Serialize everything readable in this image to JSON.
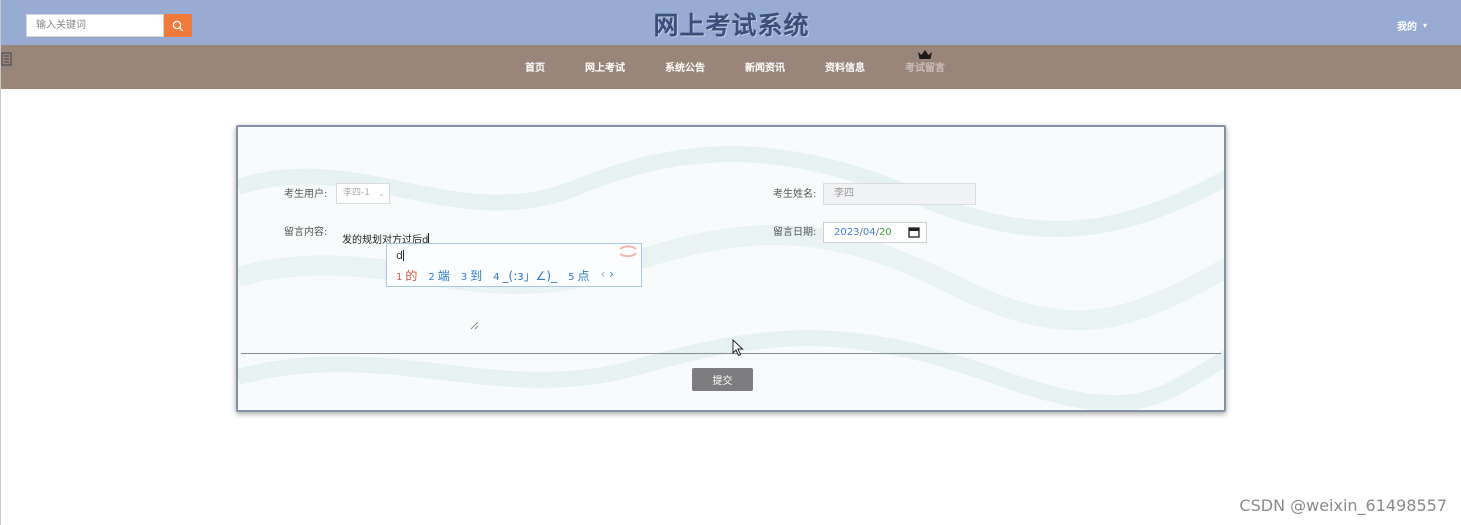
{
  "header": {
    "search_placeholder": "输入关键词",
    "title": "网上考试系统",
    "user_menu": "我的"
  },
  "nav": {
    "items": [
      "首页",
      "网上考试",
      "系统公告",
      "新闻资讯",
      "资料信息",
      "考试留言"
    ],
    "active_index": 5
  },
  "form": {
    "user_label": "考生用户:",
    "user_value": "李四-1",
    "name_label": "考生姓名:",
    "name_value": "李四",
    "content_label": "留言内容:",
    "content_value": "发的规划对方过后d",
    "date_label": "留言日期:",
    "date": {
      "year": "2023",
      "month": "04",
      "day": "20"
    },
    "submit_label": "提交"
  },
  "ime": {
    "input": "d",
    "candidates": [
      {
        "num": "1",
        "text": "的"
      },
      {
        "num": "2",
        "text": "端"
      },
      {
        "num": "3",
        "text": "到"
      },
      {
        "num": "4",
        "text": "_(:з」∠)_"
      },
      {
        "num": "5",
        "text": "点"
      }
    ]
  },
  "watermark": "CSDN @weixin_61498557",
  "colors": {
    "header_bg": "#97abd3",
    "nav_bg": "#9a857a",
    "search_button": "#f07a3c",
    "submit_button": "#7d7d7f"
  },
  "icons": [
    "search-icon",
    "chevron-down-icon",
    "crown-icon",
    "menu-toggle-icon",
    "calendar-icon",
    "resize-grip-icon",
    "mouse-cursor-icon",
    "ime-logo-icon"
  ]
}
